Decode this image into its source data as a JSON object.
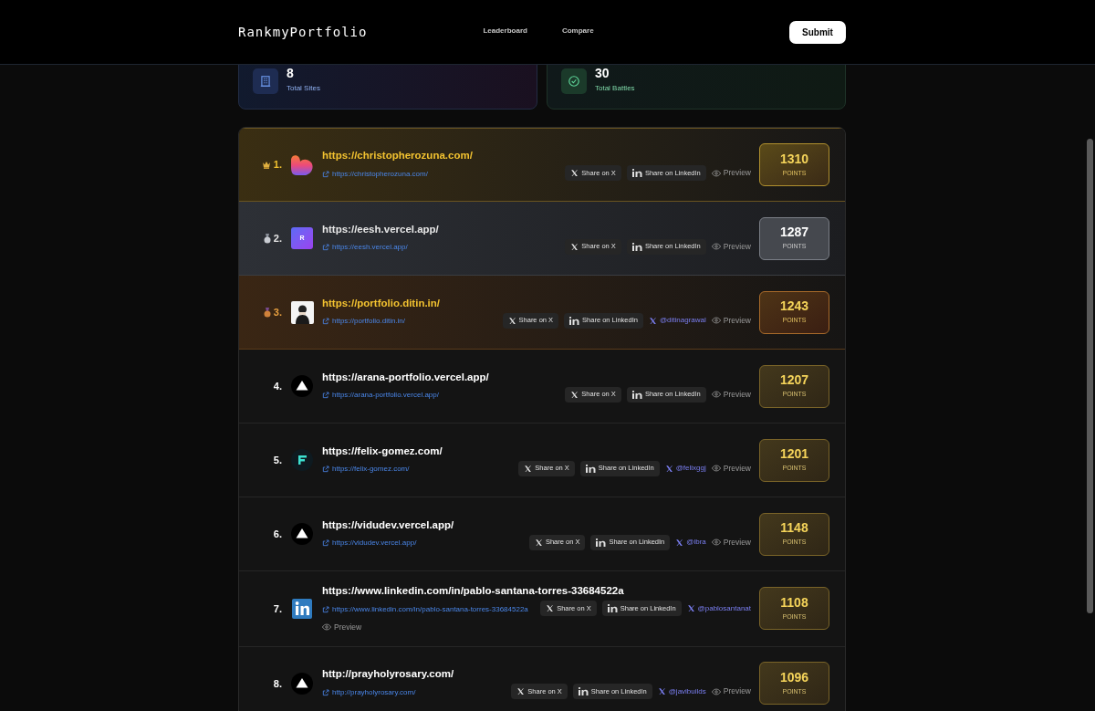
{
  "header": {
    "logo": "RankmyPortfolio",
    "nav": [
      {
        "label": "Leaderboard"
      },
      {
        "label": "Compare"
      }
    ],
    "submit": "Submit"
  },
  "stats": [
    {
      "kind": "sites",
      "value": "8",
      "label": "Total Sites"
    },
    {
      "kind": "battles",
      "value": "30",
      "label": "Total Battles"
    }
  ],
  "entries": [
    {
      "rank": "1.",
      "kind": "gold",
      "logo": {
        "kind": "heart"
      },
      "title": "https://christopherozuna.com/",
      "link": "https://christopherozuna.com/",
      "share_x": "Share on X",
      "share_linkedin": "Share on LinkedIn",
      "preview": "Preview",
      "points": "1310",
      "points_label": "POINTS"
    },
    {
      "rank": "2.",
      "kind": "silver",
      "logo": {
        "kind": "letter",
        "text": "R"
      },
      "title": "https://eesh.vercel.app/",
      "link": "https://eesh.vercel.app/",
      "share_x": "Share on X",
      "share_linkedin": "Share on LinkedIn",
      "preview": "Preview",
      "points": "1287",
      "points_label": "POINTS"
    },
    {
      "rank": "3.",
      "kind": "bronze",
      "title": "https://portfolio.ditin.in/",
      "link": "https://portfolio.ditin.in/",
      "share_x": "Share on X",
      "share_linkedin": "Share on LinkedIn",
      "handle": "@ditinagrawal",
      "preview": "Preview",
      "points": "1243",
      "points_label": "POINTS"
    },
    {
      "rank": "4.",
      "kind": "normal",
      "logo": {
        "kind": "triangle"
      },
      "title": "https://arana-portfolio.vercel.app/",
      "link": "https://arana-portfolio.vercel.app/",
      "share_x": "Share on X",
      "share_linkedin": "Share on LinkedIn",
      "preview": "Preview",
      "points": "1207",
      "points_label": "POINTS"
    },
    {
      "rank": "5.",
      "kind": "normal",
      "logo": {
        "kind": "f-mark"
      },
      "title": "https://felix-gomez.com/",
      "link": "https://felix-gomez.com/",
      "share_x": "Share on X",
      "share_linkedin": "Share on LinkedIn",
      "handle": "@felixggj",
      "preview": "Preview",
      "points": "1201",
      "points_label": "POINTS"
    },
    {
      "rank": "6.",
      "kind": "normal",
      "logo": {
        "kind": "triangle"
      },
      "title": "https://vidudev.vercel.app/",
      "link": "https://vidudev.vercel.app/",
      "share_x": "Share on X",
      "share_linkedin": "Share on LinkedIn",
      "handle": "@ibra",
      "preview": "Preview",
      "points": "1148",
      "points_label": "POINTS"
    },
    {
      "rank": "7.",
      "kind": "normal",
      "logo": {
        "kind": "linkedin"
      },
      "title": "https://www.linkedin.com/in/pablo-santana-torres-33684522a",
      "link": "https://www.linkedin.com/in/pablo-santana-torres-33684522a",
      "share_x": "Share on X",
      "share_linkedin": "Share on LinkedIn",
      "handle": "@pablosantanat",
      "preview": "Preview",
      "points": "1108",
      "points_label": "POINTS"
    },
    {
      "rank": "8.",
      "kind": "normal",
      "logo": {
        "kind": "triangle"
      },
      "title": "http://prayholyrosary.com/",
      "link": "http://prayholyrosary.com/",
      "share_x": "Share on X",
      "share_linkedin": "Share on LinkedIn",
      "handle": "@javibuilds",
      "preview": "Preview",
      "points": "1096",
      "points_label": "POINTS"
    }
  ]
}
